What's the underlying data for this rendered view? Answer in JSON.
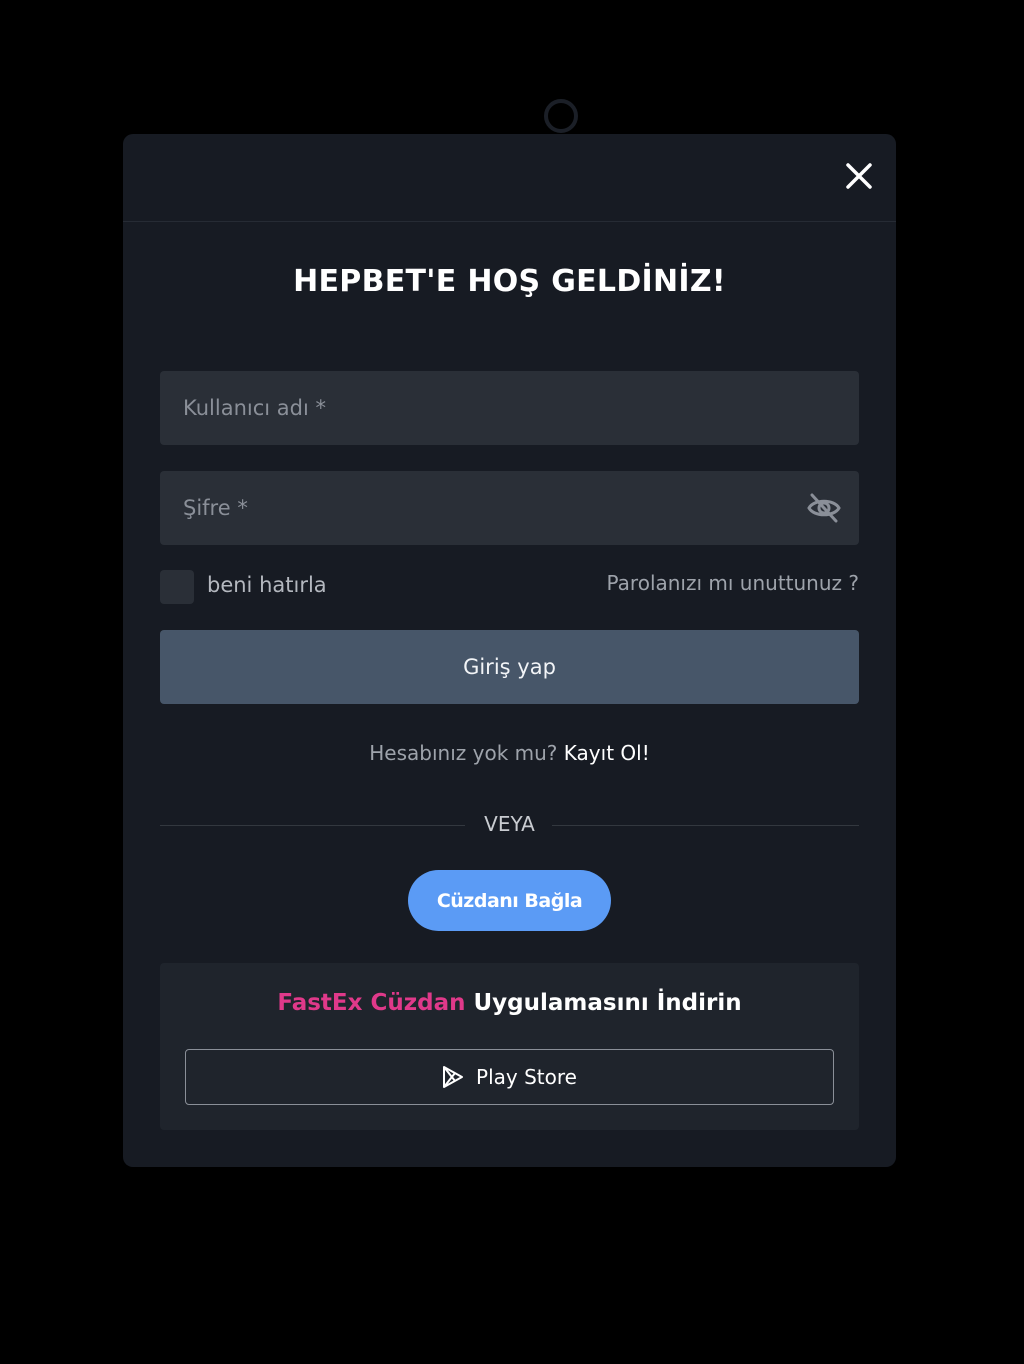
{
  "modal": {
    "title": "HEPBET'E HOŞ GELDİNİZ!"
  },
  "login_form": {
    "username_placeholder": "Kullanıcı adı *",
    "password_placeholder": "Şifre *",
    "remember_label": "beni hatırla",
    "remember_checked": false,
    "forgot_link": "Parolanızı mı unuttunuz ?",
    "submit_label": "Giriş yap"
  },
  "signup": {
    "prompt": "Hesabınız yok mu?",
    "link": "Kayıt Ol!"
  },
  "divider": {
    "label": "VEYA"
  },
  "wallet": {
    "connect_label": "Cüzdanı Bağla"
  },
  "app_promo": {
    "brand": "FastEx Cüzdan",
    "text": "Uygulamasını İndirin",
    "store_label": "Play Store",
    "brand_color": "#e0398a"
  },
  "icons": {
    "close": "close-icon",
    "password_toggle": "eye-slash-icon",
    "store": "play-store-icon"
  },
  "colors": {
    "modal_bg": "#171b23",
    "field_bg": "#2a2f37",
    "login_button": "#475669",
    "wallet_button": "#5b9bf5"
  }
}
